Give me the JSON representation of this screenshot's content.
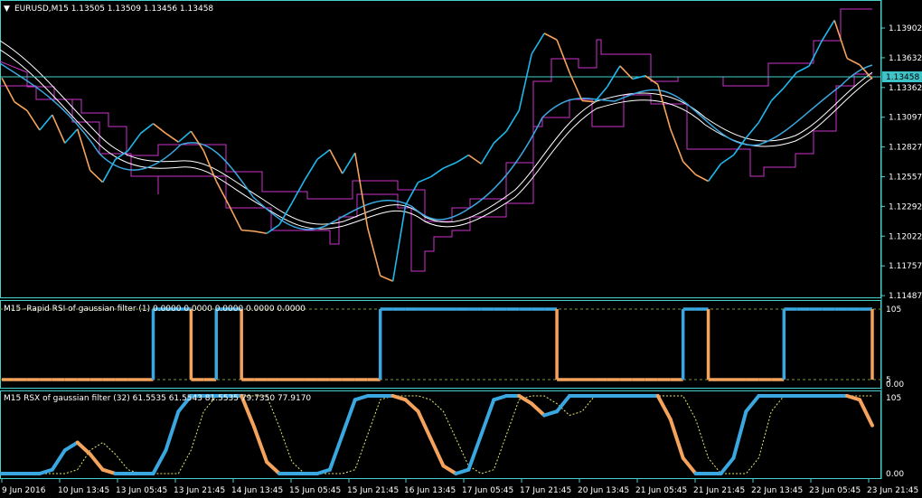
{
  "colors": {
    "background": "#000000",
    "frame": "#48d1cc",
    "price_up": "#1fb8ec",
    "price_down": "#f5a35c",
    "channel": "#cc33cc",
    "ma_white": "#ffffff",
    "ma_blue": "#3aa7e0",
    "rsx_signal": "#e8e870",
    "level": "#7c9a3a",
    "current_price_bg": "#3fc3c8"
  },
  "main_panel": {
    "title": "EURUSD,M15  1.13505 1.13509 1.13456 1.13458",
    "current_price": "1.13458",
    "y_ticks": [
      "1.13902",
      "1.13632",
      "1.13362",
      "1.13097",
      "1.12827",
      "1.12557",
      "1.12292",
      "1.12022",
      "1.11757",
      "1.11487"
    ]
  },
  "rsi_panel": {
    "title": "M15 -Rapid RSI of gaussian filter (1) 0.0000 0.0000 0.0000 0.0000 0.0000",
    "y_ticks": [
      "105",
      "5",
      "0.00"
    ]
  },
  "rsx_panel": {
    "title": "M15  RSX of gaussian filter (32) 61.5535 61.5543 81.5535 79.7350 77.9170",
    "y_ticks": [
      "105",
      "0.00"
    ]
  },
  "x_ticks": [
    "9 Jun 2016",
    "10 Jun 13:45",
    "13 Jun 05:45",
    "13 Jun 21:45",
    "14 Jun 13:45",
    "15 Jun 05:45",
    "15 Jun 21:45",
    "16 Jun 13:45",
    "17 Jun 05:45",
    "17 Jun 21:45",
    "20 Jun 13:45",
    "21 Jun 05:45",
    "21 Jun 21:45",
    "22 Jun 13:45",
    "23 Jun 05:45",
    "23 Jun 21:45"
  ],
  "chart_data": [
    {
      "type": "line",
      "title": "EURUSD,M15  1.13505 1.13509 1.13456 1.13458",
      "ylim": [
        1.1146,
        1.1417
      ],
      "series": [
        {
          "values": [
            1.1347,
            1.1325,
            1.1317,
            1.1299,
            1.1313,
            1.1287,
            1.13,
            1.1262,
            1.1251,
            1.1272,
            1.128,
            1.1296,
            1.1305,
            1.1296,
            1.1288,
            1.1298,
            1.128,
            1.1252,
            1.123,
            1.1207,
            1.1206,
            1.1204,
            1.1212,
            1.1232,
            1.1253,
            1.1272,
            1.1281,
            1.1259,
            1.1278,
            1.1209,
            1.1165,
            1.116,
            1.123,
            1.1251,
            1.1256,
            1.1264,
            1.1269,
            1.1276,
            1.1268,
            1.1287,
            1.1298,
            1.1317,
            1.1369,
            1.1388,
            1.1382,
            1.1352,
            1.1326,
            1.1325,
            1.1339,
            1.1358,
            1.1346,
            1.1349,
            1.1341,
            1.13,
            1.127,
            1.1258,
            1.1252,
            1.1268,
            1.1276,
            1.1292,
            1.1306,
            1.1326,
            1.1338,
            1.1352,
            1.1358,
            1.1381,
            1.14,
            1.1365,
            1.1359,
            1.1346
          ]
        }
      ]
    },
    {
      "type": "line",
      "title": "M15 -Rapid RSI of gaussian filter (1) 0.0000 0.0000 0.0000 0.0000 0.0000",
      "ylim": [
        0,
        105
      ],
      "series": [
        {
          "values": [
            0,
            0,
            0,
            0,
            0,
            0,
            0,
            0,
            0,
            0,
            0,
            0,
            100,
            100,
            100,
            0,
            0,
            100,
            100,
            0,
            0,
            0,
            0,
            0,
            0,
            0,
            0,
            0,
            0,
            0,
            100,
            100,
            100,
            100,
            100,
            100,
            100,
            100,
            100,
            100,
            100,
            100,
            100,
            100,
            0,
            0,
            0,
            0,
            0,
            0,
            0,
            0,
            0,
            0,
            100,
            100,
            0,
            0,
            0,
            0,
            0,
            0,
            100,
            100,
            100,
            100,
            100,
            100,
            100,
            0
          ]
        }
      ]
    },
    {
      "type": "line",
      "title": "M15  RSX of gaussian filter (32) 61.5535 61.5543 81.5535 79.7350 77.9170",
      "ylim": [
        0,
        105
      ],
      "series": [
        {
          "values": [
            0,
            0,
            0,
            0,
            5,
            30,
            40,
            25,
            5,
            0,
            0,
            0,
            0,
            30,
            80,
            100,
            100,
            100,
            100,
            100,
            60,
            15,
            0,
            0,
            0,
            0,
            5,
            50,
            95,
            100,
            100,
            100,
            95,
            80,
            45,
            10,
            0,
            5,
            50,
            95,
            100,
            100,
            90,
            75,
            80,
            100,
            100,
            100,
            100,
            100,
            100,
            100,
            100,
            70,
            20,
            0,
            0,
            0,
            20,
            80,
            100,
            100,
            100,
            100,
            100,
            100,
            100,
            100,
            95,
            62
          ]
        }
      ]
    }
  ]
}
